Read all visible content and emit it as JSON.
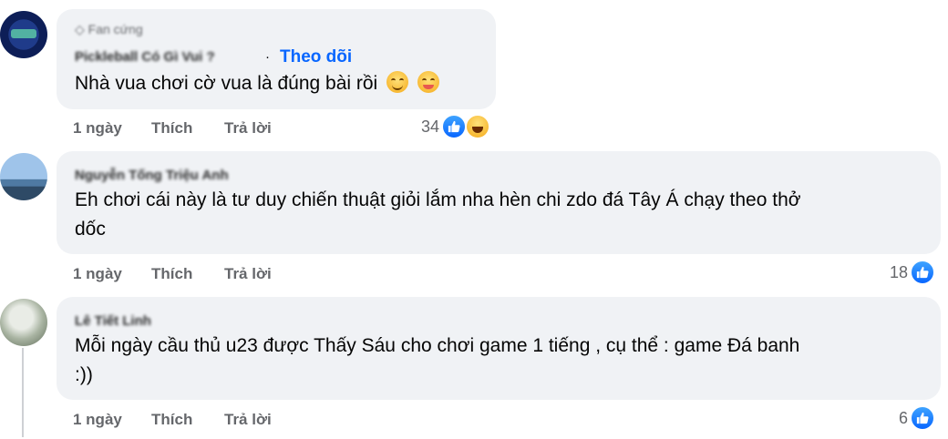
{
  "comments": [
    {
      "badge": "Fan cứng",
      "name": "Pickleball Có Gì Vui ?",
      "follow": "Theo dõi",
      "separator": "·",
      "text": "Nhà vua chơi cờ vua là đúng bài rồi",
      "emojis": [
        "smiling-face-icon",
        "tongue-face-icon"
      ],
      "time": "1 ngày",
      "like": "Thích",
      "reply": "Trả lời",
      "reaction_count": "34",
      "reactions": [
        "like",
        "haha"
      ]
    },
    {
      "name": "Nguyễn Tống Triệu Anh",
      "text_lines": [
        "Eh chơi cái này là tư duy chiến thuật giỏi lắm nha hèn chi zdo đá Tây Á chạy theo thở",
        "dốc"
      ],
      "time": "1 ngày",
      "like": "Thích",
      "reply": "Trả lời",
      "reaction_count": "18",
      "reactions": [
        "like"
      ]
    },
    {
      "name": "Lê Tiết Linh",
      "text_lines": [
        "Mỗi ngày cầu thủ u23 được Thấy Sáu cho chơi game 1 tiếng , cụ thể : game Đá banh",
        ":))"
      ],
      "time": "1 ngày",
      "like": "Thích",
      "reply": "Trả lời",
      "reaction_count": "6",
      "reactions": [
        "like"
      ]
    }
  ],
  "colors": {
    "bubble": "#f0f2f5",
    "link": "#0866ff",
    "muted": "#65676b",
    "like": "#0866ff"
  }
}
